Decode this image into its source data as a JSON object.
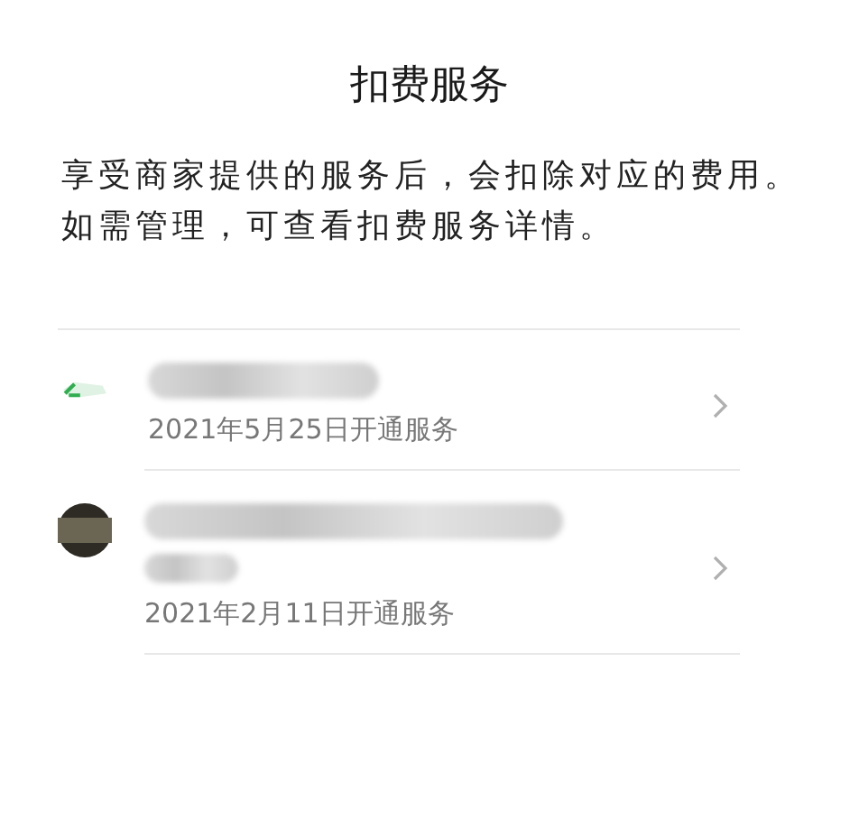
{
  "title": "扣费服务",
  "description": "享受商家提供的服务后，会扣除对应的费用。如需管理，可查看扣费服务详情。",
  "services": [
    {
      "kind": "app",
      "blurred_subtitle": false,
      "date": "2021年5月25日开通服务"
    },
    {
      "kind": "avatar",
      "blurred_subtitle": true,
      "date": "2021年2月11日开通服务"
    }
  ]
}
